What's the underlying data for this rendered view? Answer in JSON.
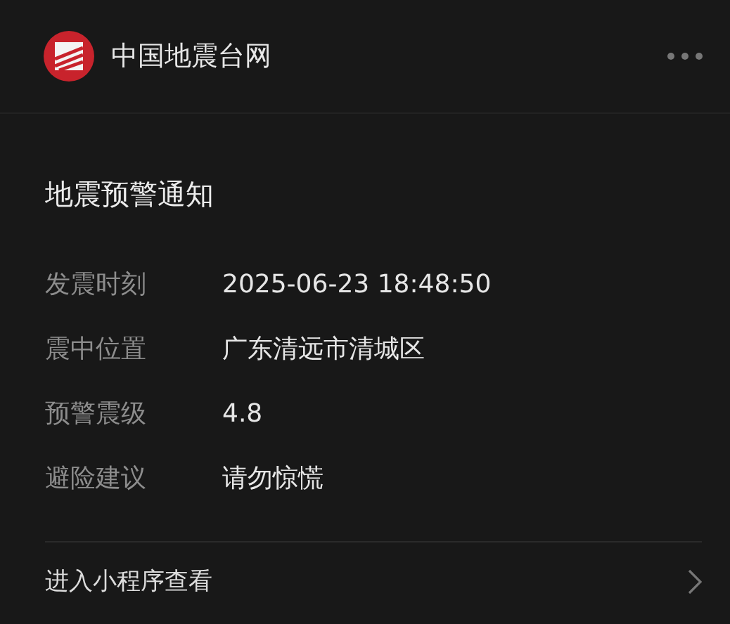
{
  "header": {
    "title": "中国地震台网"
  },
  "card": {
    "title": "地震预警通知",
    "fields": [
      {
        "label": "发震时刻",
        "value": "2025-06-23 18:48:50"
      },
      {
        "label": "震中位置",
        "value": "广东清远市清城区"
      },
      {
        "label": "预警震级",
        "value": "4.8"
      },
      {
        "label": "避险建议",
        "value": "请勿惊慌"
      }
    ]
  },
  "footer": {
    "link": "进入小程序查看"
  }
}
